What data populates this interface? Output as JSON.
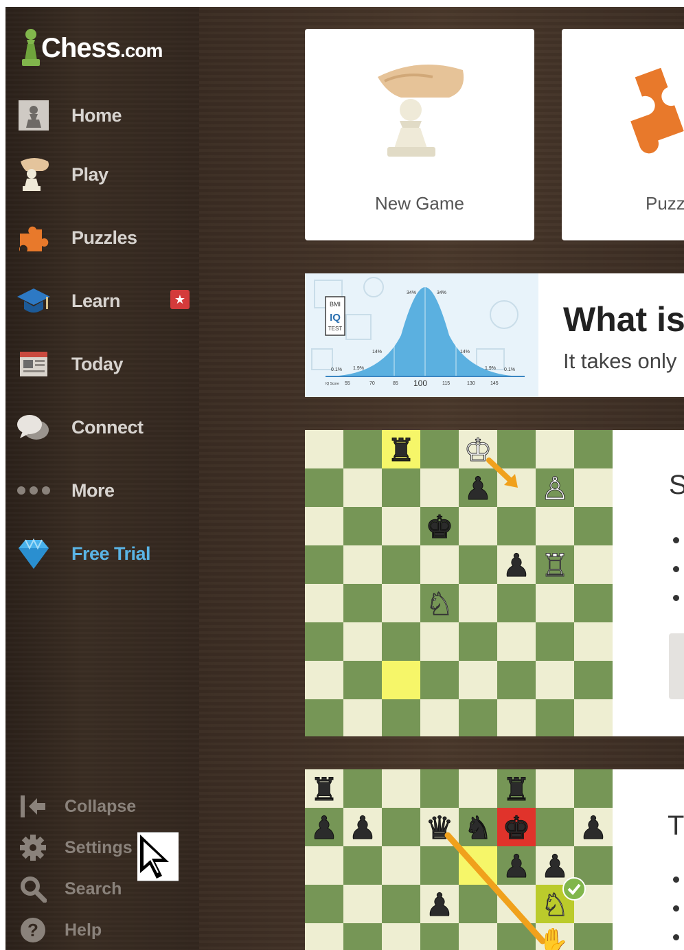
{
  "brand": {
    "name": "Chess",
    "suffix": ".com"
  },
  "nav": [
    {
      "label": "Home",
      "icon": "home-icon"
    },
    {
      "label": "Play",
      "icon": "play-icon"
    },
    {
      "label": "Puzzles",
      "icon": "puzzles-icon"
    },
    {
      "label": "Learn",
      "icon": "learn-icon",
      "badge": "★"
    },
    {
      "label": "Today",
      "icon": "today-icon"
    },
    {
      "label": "Connect",
      "icon": "connect-icon"
    },
    {
      "label": "More",
      "icon": "more-icon"
    },
    {
      "label": "Free Trial",
      "icon": "diamond-icon"
    }
  ],
  "bottom": [
    {
      "label": "Collapse",
      "icon": "collapse-icon"
    },
    {
      "label": "Settings",
      "icon": "gear-icon"
    },
    {
      "label": "Search",
      "icon": "search-icon"
    },
    {
      "label": "Help",
      "icon": "help-icon"
    }
  ],
  "cards": {
    "new_game": "New Game",
    "puzzles": "Puzz"
  },
  "banner": {
    "headline": "What is",
    "subline": "It takes only",
    "logo_lines": [
      "BMI",
      "IQ",
      "TEST"
    ],
    "percent_labels": [
      "34%",
      "34%",
      "14%",
      "14%",
      "0.1%",
      "1.9%",
      "1.9%",
      "0.1%"
    ],
    "axis_prefix": "IQ Score",
    "axis_ticks": [
      "55",
      "70",
      "85",
      "100",
      "115",
      "130",
      "145"
    ]
  },
  "lesson1": {
    "title_partial": "S"
  },
  "lesson2": {
    "title_partial": "T"
  },
  "colors": {
    "light_square": "#eeeed2",
    "dark_square": "#769656",
    "highlight": "#f6f669",
    "arrow": "#f0a11c",
    "check": "#e0332b"
  }
}
